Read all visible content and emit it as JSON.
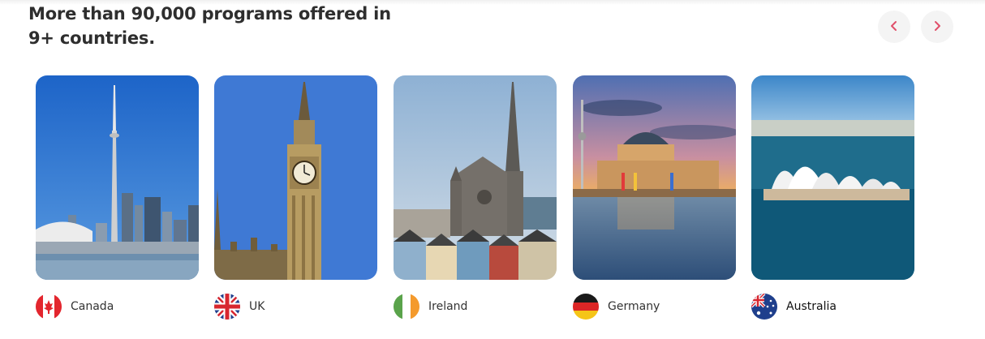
{
  "section": {
    "heading": "More than 90,000 programs offered in 9+ countries."
  },
  "carousel": {
    "prev_icon": "chevron-left-icon",
    "next_icon": "chevron-right-icon",
    "accent_color": "#e0506a",
    "cards": [
      {
        "country": "Canada",
        "flag_icon": "canada-flag-icon",
        "image": "toronto-cn-tower-image"
      },
      {
        "country": "UK",
        "flag_icon": "uk-flag-icon",
        "image": "london-big-ben-image"
      },
      {
        "country": "Ireland",
        "flag_icon": "ireland-flag-icon",
        "image": "cobh-cathedral-image"
      },
      {
        "country": "Germany",
        "flag_icon": "germany-flag-icon",
        "image": "berlin-bode-museum-image"
      },
      {
        "country": "Australia",
        "flag_icon": "australia-flag-icon",
        "image": "sydney-opera-house-image"
      }
    ]
  }
}
